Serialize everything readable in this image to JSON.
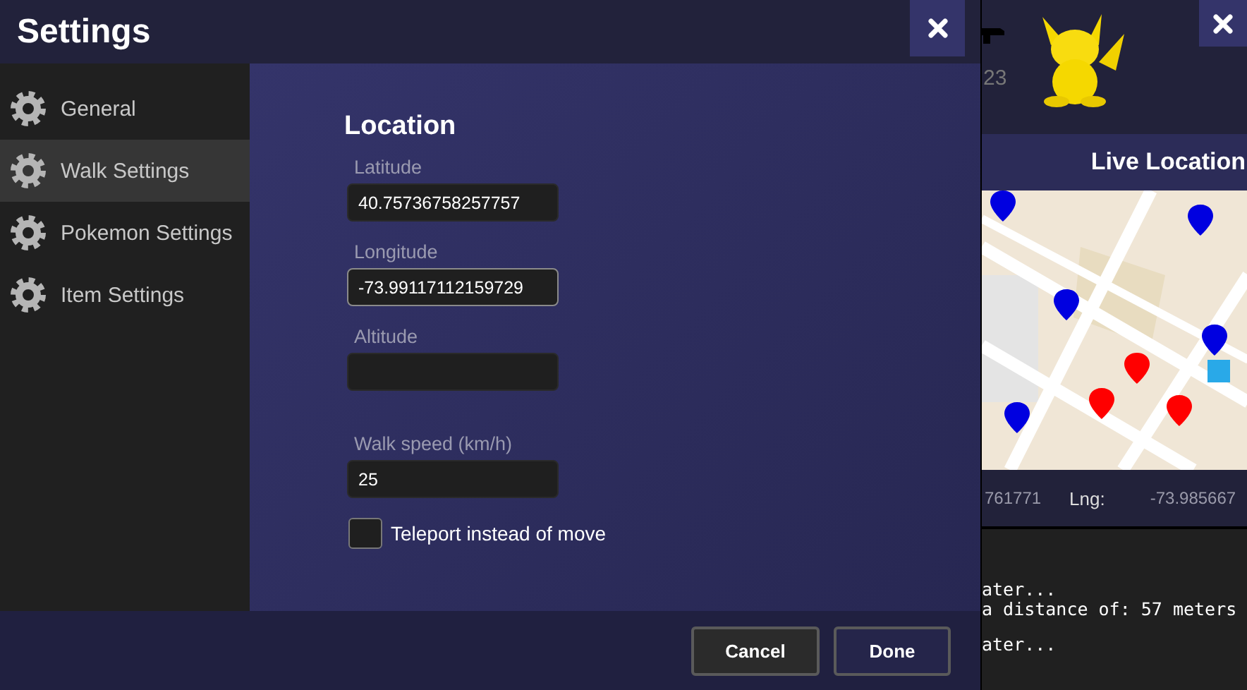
{
  "dialog": {
    "title": "Settings",
    "sidebar": {
      "items": [
        {
          "label": "General",
          "selected": false
        },
        {
          "label": "Walk Settings",
          "selected": true
        },
        {
          "label": "Pokemon Settings",
          "selected": false
        },
        {
          "label": "Item Settings",
          "selected": false
        }
      ]
    },
    "section_title": "Location",
    "fields": [
      {
        "label": "Latitude",
        "value": "40.75736758257757",
        "focused": false
      },
      {
        "label": "Longitude",
        "value": "-73.99117112159729",
        "focused": true
      },
      {
        "label": "Altitude",
        "focused": false
      },
      {
        "label": "Walk speed (km/h)",
        "value": "25",
        "focused": false
      }
    ],
    "checkbox": {
      "label": "Teleport instead of move",
      "checked": false
    },
    "buttons": [
      "Cancel",
      "Done"
    ]
  },
  "background_window": {
    "partial_text": "23",
    "header": "Live Location",
    "coordinates": {
      "lat_value": "761771",
      "lng_label": "Lng:",
      "lng_value": "-73.985667"
    },
    "console": {
      "blocks": [
        [
          "ater...",
          "a distance of: 57 meters"
        ],
        [
          "ater..."
        ]
      ]
    }
  }
}
